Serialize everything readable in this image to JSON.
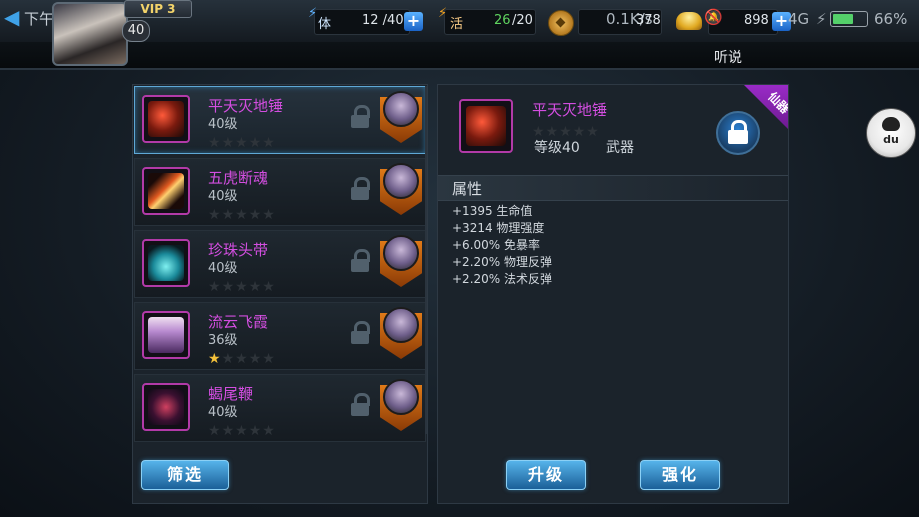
{
  "status": {
    "time": "下午3:44",
    "network_speed": "0.1K/s",
    "network_type": "4G",
    "battery_percent": "66%",
    "battery_level": 0.66
  },
  "player": {
    "vip": "VIP 3",
    "level": "40"
  },
  "resources": {
    "stamina_label": "体",
    "stamina_value": "12 /40",
    "vigor_label": "活",
    "vigor_current": "26",
    "vigor_max": "/20",
    "coins": "378",
    "ingots": "898"
  },
  "notice": "听说",
  "items": [
    {
      "name": "平天灭地锤",
      "level": "40级",
      "stars": 0,
      "selected": true,
      "art": "hammer"
    },
    {
      "name": "五虎断魂",
      "level": "40级",
      "stars": 0,
      "selected": false,
      "art": "blade"
    },
    {
      "name": "珍珠头带",
      "level": "40级",
      "stars": 0,
      "selected": false,
      "art": "headband"
    },
    {
      "name": "流云飞霞",
      "level": "36级",
      "stars": 1,
      "selected": false,
      "art": "robe"
    },
    {
      "name": "蝎尾鞭",
      "level": "40级",
      "stars": 0,
      "selected": false,
      "art": "whip"
    }
  ],
  "filter_button": "筛选",
  "detail": {
    "name": "平天灭地锤",
    "stars": 0,
    "level": "等级40",
    "type": "武器",
    "tag": "仙器",
    "attr_title": "属性",
    "attributes": [
      "+1395 生命值",
      "+3214 物理强度",
      "+6.00% 免暴率",
      "+2.20% 物理反弹",
      "+2.20% 法术反弹"
    ]
  },
  "upgrade_button": "升级",
  "enhance_button": "强化",
  "float_button": "du",
  "colors": {
    "accent": "#3fa2e8",
    "item_name": "#d34ee0",
    "star_on": "#f4c13a",
    "button": "#1b5f98"
  }
}
